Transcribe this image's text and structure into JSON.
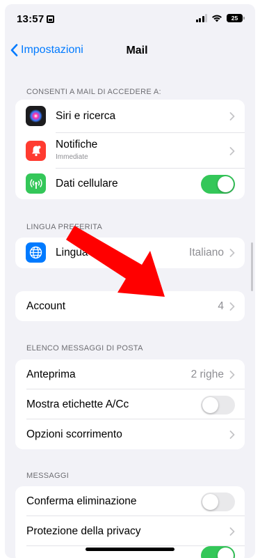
{
  "status_bar": {
    "time": "13:57",
    "battery": "25"
  },
  "nav": {
    "back_label": "Impostazioni",
    "title": "Mail"
  },
  "sections": {
    "access": {
      "header": "CONSENTI A MAIL DI ACCEDERE A:",
      "siri": "Siri e ricerca",
      "notifications": "Notifiche",
      "notifications_sub": "Immediate",
      "cellular": "Dati cellulare"
    },
    "language": {
      "header": "LINGUA PREFERITA",
      "label": "Lingua",
      "value": "Italiano"
    },
    "account": {
      "label": "Account",
      "value": "4"
    },
    "message_list": {
      "header": "ELENCO MESSAGGI DI POSTA",
      "preview": "Anteprima",
      "preview_value": "2 righe",
      "show_to_cc": "Mostra etichette A/Cc",
      "swipe_options": "Opzioni scorrimento"
    },
    "messages": {
      "header": "MESSAGGI",
      "confirm_delete": "Conferma eliminazione",
      "privacy": "Protezione della privacy"
    }
  },
  "toggles": {
    "cellular": true,
    "show_to_cc": false,
    "confirm_delete": false,
    "partial_next": true
  },
  "colors": {
    "accent": "#007aff",
    "toggle_on": "#34c759",
    "arrow": "#ff0000",
    "siri_icon": "#1c1c1e",
    "notif_icon": "#ff3b30",
    "cell_icon": "#34c759",
    "globe_icon": "#007aff"
  },
  "icons": {
    "siri": "siri-icon",
    "notifications": "bell-icon",
    "cellular": "antenna-icon",
    "language": "globe-icon"
  },
  "overlay": {
    "annotation": "red-arrow-pointing-to-account"
  }
}
